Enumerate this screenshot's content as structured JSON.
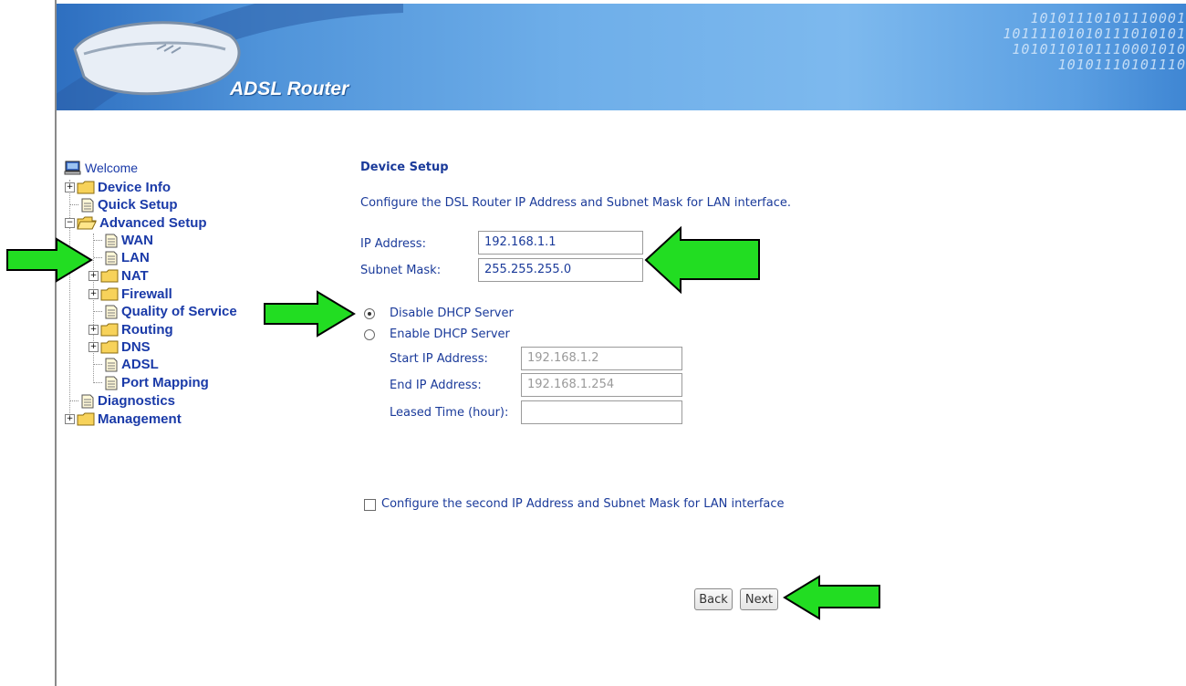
{
  "banner": {
    "title": "ADSL Router",
    "binary_lines": [
      "10101110101110001",
      "10111101010111010101",
      "1010110101110001010",
      "10101110101110"
    ]
  },
  "nav": {
    "items": [
      {
        "label": "Welcome",
        "name": "nav-welcome"
      },
      {
        "label": "Device Info",
        "name": "nav-device-info"
      },
      {
        "label": "Quick Setup",
        "name": "nav-quick-setup"
      },
      {
        "label": "Advanced Setup",
        "name": "nav-advanced-setup"
      },
      {
        "label": "WAN",
        "name": "nav-wan"
      },
      {
        "label": "LAN",
        "name": "nav-lan"
      },
      {
        "label": "NAT",
        "name": "nav-nat"
      },
      {
        "label": "Firewall",
        "name": "nav-firewall"
      },
      {
        "label": "Quality of Service",
        "name": "nav-qos"
      },
      {
        "label": "Routing",
        "name": "nav-routing"
      },
      {
        "label": "DNS",
        "name": "nav-dns"
      },
      {
        "label": "ADSL",
        "name": "nav-adsl"
      },
      {
        "label": "Port Mapping",
        "name": "nav-port-mapping"
      },
      {
        "label": "Diagnostics",
        "name": "nav-diagnostics"
      },
      {
        "label": "Management",
        "name": "nav-management"
      }
    ],
    "expand_symbol": "+",
    "collapse_symbol": "−"
  },
  "main": {
    "heading": "Device Setup",
    "description": "Configure the DSL Router IP Address and Subnet Mask for LAN interface.",
    "ip_label": "IP Address:",
    "ip_value": "192.168.1.1",
    "mask_label": "Subnet Mask:",
    "mask_value": "255.255.255.0",
    "disable_dhcp_label": "Disable DHCP Server",
    "enable_dhcp_label": "Enable DHCP Server",
    "dhcp_selected": "disable",
    "start_ip_label": "Start IP Address:",
    "start_ip_value": "192.168.1.2",
    "end_ip_label": "End IP Address:",
    "end_ip_value": "192.168.1.254",
    "lease_label": "Leased Time (hour):",
    "lease_value": "",
    "second_ip_label": "Configure the second IP Address and Subnet Mask for LAN interface",
    "second_ip_checked": false,
    "back_label": "Back",
    "next_label": "Next"
  },
  "colors": {
    "link": "#1a3aa8",
    "text": "#1a3a9a",
    "arrow_fill": "#22dd22",
    "banner": "#5b9fe2"
  }
}
